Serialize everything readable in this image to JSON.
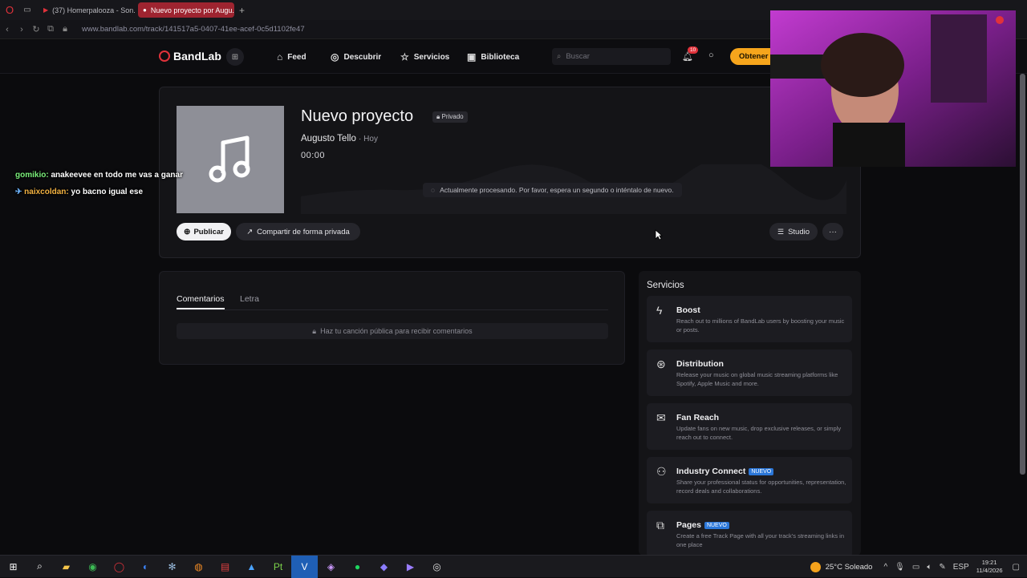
{
  "browser": {
    "tabs": [
      {
        "label": "(37) Homerpalooza - Son...",
        "active": false
      },
      {
        "label": "Nuevo proyecto por Augu...",
        "active": true
      }
    ],
    "url": "www.bandlab.com/track/141517a5-0407-41ee-acef-0c5d1102fe47"
  },
  "nav": {
    "logo": "BandLab",
    "items": [
      {
        "label": "Feed",
        "icon": "home-icon"
      },
      {
        "label": "Descubrir",
        "icon": "compass-icon"
      },
      {
        "label": "Servicios",
        "icon": "star-icon"
      },
      {
        "label": "Biblioteca",
        "icon": "library-icon"
      }
    ],
    "search_placeholder": "Buscar",
    "notifications_count": "10",
    "cta_label": "Obtener"
  },
  "track": {
    "title": "Nuevo proyecto",
    "privacy": "Privado",
    "artist": "Augusto Tello",
    "when": "· Hoy",
    "time": "00:00",
    "processing_message": "Actualmente procesando. Por favor, espera un segundo o inténtalo de nuevo.",
    "publish_label": "Publicar",
    "share_label": "Compartir de forma privada",
    "studio_label": "Studio",
    "more_label": "···"
  },
  "comments": {
    "tabs": [
      "Comentarios",
      "Letra"
    ],
    "note": "Haz tu canción pública para recibir comentarios"
  },
  "services": {
    "heading": "Servicios",
    "items": [
      {
        "name": "Boost",
        "desc": "Reach out to millions of BandLab users by boosting your music or posts.",
        "badge": "",
        "icon": "bolt-icon"
      },
      {
        "name": "Distribution",
        "desc": "Release your music on global music streaming platforms like Spotify, Apple Music and more.",
        "badge": "",
        "icon": "distribution-icon"
      },
      {
        "name": "Fan Reach",
        "desc": "Update fans on new music, drop exclusive releases, or simply reach out to connect.",
        "badge": "",
        "icon": "mail-icon"
      },
      {
        "name": "Industry Connect",
        "desc": "Share your professional status for opportunities, representation, record deals and collaborations.",
        "badge": "NUEVO",
        "icon": "people-icon"
      },
      {
        "name": "Pages",
        "desc": "Create a free Track Page with all your track's streaming links in one place",
        "badge": "NUEVO",
        "icon": "pages-icon"
      }
    ]
  },
  "chat": [
    {
      "user": "gomikio:",
      "message": "anakeevee en todo me vas a ganar"
    },
    {
      "user": "naixcoldan:",
      "message": "yo bacno igual ese"
    }
  ],
  "taskbar": {
    "weather": "25°C  Soleado",
    "lang": "ESP",
    "time": "19:21",
    "date": "11/4/2026"
  }
}
